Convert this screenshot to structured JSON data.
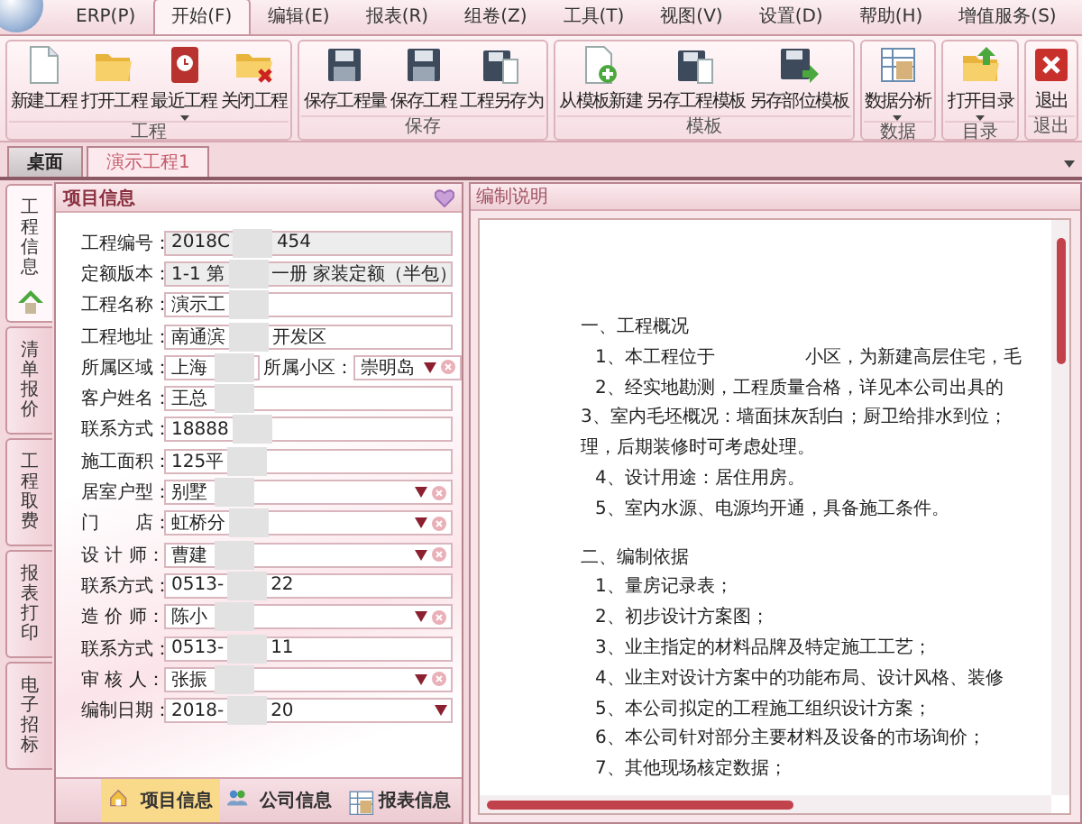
{
  "menu": {
    "tabs": [
      {
        "label": "ERP(P)",
        "selected": false
      },
      {
        "label": "开始(F)",
        "selected": true
      },
      {
        "label": "编辑(E)",
        "selected": false
      },
      {
        "label": "报表(R)",
        "selected": false
      },
      {
        "label": "组卷(Z)",
        "selected": false
      },
      {
        "label": "工具(T)",
        "selected": false
      },
      {
        "label": "视图(V)",
        "selected": false
      },
      {
        "label": "设置(D)",
        "selected": false
      },
      {
        "label": "帮助(H)",
        "selected": false
      },
      {
        "label": "增值服务(S)",
        "selected": false
      }
    ]
  },
  "ribbon": {
    "groups": [
      {
        "title": "工程",
        "buttons": [
          {
            "label": "新建工程",
            "kind": "new",
            "dropdown": false
          },
          {
            "label": "打开工程",
            "kind": "open",
            "dropdown": false
          },
          {
            "label": "最近工程",
            "kind": "recent",
            "dropdown": true
          },
          {
            "label": "关闭工程",
            "kind": "close",
            "dropdown": false
          }
        ]
      },
      {
        "title": "保存",
        "buttons": [
          {
            "label": "保存工程量",
            "kind": "save",
            "dropdown": false
          },
          {
            "label": "保存工程",
            "kind": "save",
            "dropdown": false
          },
          {
            "label": "工程另存为",
            "kind": "saveas",
            "dropdown": false
          }
        ]
      },
      {
        "title": "模板",
        "buttons": [
          {
            "label": "从模板新建",
            "kind": "fromtpl",
            "dropdown": false
          },
          {
            "label": "另存工程模板",
            "kind": "saveas",
            "dropdown": false
          },
          {
            "label": "另存部位模板",
            "kind": "savearrow",
            "dropdown": false
          }
        ]
      },
      {
        "title": "数据",
        "buttons": [
          {
            "label": "数据分析",
            "kind": "table",
            "dropdown": true
          }
        ]
      },
      {
        "title": "目录",
        "buttons": [
          {
            "label": "打开目录",
            "kind": "opendir",
            "dropdown": true
          }
        ]
      },
      {
        "title": "退出",
        "buttons": [
          {
            "label": "退出",
            "kind": "exit",
            "dropdown": false
          }
        ]
      }
    ]
  },
  "document_tabs": [
    {
      "label": "桌面",
      "selected": false
    },
    {
      "label": "演示工程1",
      "selected": true
    }
  ],
  "side_tabs": [
    {
      "label": "工程信息",
      "selected": true
    },
    {
      "label": "清单报价",
      "selected": false
    },
    {
      "label": "工程取费",
      "selected": false
    },
    {
      "label": "报表打印",
      "selected": false
    },
    {
      "label": "电子招标",
      "selected": false
    }
  ],
  "project_panel": {
    "title": "项目信息",
    "fields": [
      {
        "label": "工程编号：",
        "kind": "text",
        "readonly": true,
        "value": "2018C",
        "tail": "454"
      },
      {
        "label": "定额版本：",
        "kind": "text",
        "readonly": true,
        "value": "1-1 第",
        "tail": "一册 家装定额（半包）"
      },
      {
        "label": "工程名称：",
        "kind": "text",
        "readonly": false,
        "value": "演示工"
      },
      {
        "label": "工程地址：",
        "kind": "text",
        "readonly": false,
        "value": "南通滨",
        "tail": "开发区"
      },
      {
        "label": "所属区域：",
        "kind": "pair",
        "readonly": false,
        "value": "上海",
        "label2": "所属小区：",
        "value2": "崇明岛"
      },
      {
        "label": "客户姓名：",
        "kind": "text",
        "readonly": false,
        "value": "王总"
      },
      {
        "label": "联系方式：",
        "kind": "text",
        "readonly": false,
        "value": "18888"
      },
      {
        "label": "施工面积：",
        "kind": "text",
        "readonly": false,
        "value": "125平"
      },
      {
        "label": "居室户型：",
        "kind": "select",
        "readonly": false,
        "value": "别墅"
      },
      {
        "label": "门　　店：",
        "kind": "select",
        "readonly": false,
        "value": "虹桥分"
      },
      {
        "label": "设 计 师：",
        "kind": "select",
        "readonly": false,
        "value": "曹建"
      },
      {
        "label": "联系方式：",
        "kind": "text",
        "readonly": false,
        "value": "0513-",
        "tail": "22"
      },
      {
        "label": "造 价 师：",
        "kind": "select",
        "readonly": false,
        "value": "陈小"
      },
      {
        "label": "联系方式：",
        "kind": "text",
        "readonly": false,
        "value": "0513-",
        "tail": "11"
      },
      {
        "label": "审 核 人：",
        "kind": "select",
        "readonly": false,
        "value": "张振"
      },
      {
        "label": "编制日期：",
        "kind": "date",
        "readonly": false,
        "value": "2018-",
        "tail": "20"
      }
    ],
    "bottom_tabs": [
      {
        "label": "项目信息",
        "kind": "house",
        "selected": true
      },
      {
        "label": "公司信息",
        "kind": "people",
        "selected": false
      },
      {
        "label": "报表信息",
        "kind": "table",
        "selected": false
      }
    ]
  },
  "description_panel": {
    "title": "编制说明",
    "lines": [
      {
        "kind": "heading",
        "text": "一、工程概况"
      },
      {
        "kind": "item",
        "text": "1、本工程位于　　　　　小区，为新建高层住宅，毛"
      },
      {
        "kind": "item",
        "text": "2、经实地勘测，工程质量合格，详见本公司出具的"
      },
      {
        "kind": "flush",
        "text": "3、室内毛坯概况：墙面抹灰刮白；厨卫给排水到位；"
      },
      {
        "kind": "flush",
        "text": "理，后期装修时可考虑处理。"
      },
      {
        "kind": "item",
        "text": "4、设计用途：居住用房。"
      },
      {
        "kind": "item",
        "text": "5、室内水源、电源均开通，具备施工条件。"
      },
      {
        "kind": "heading",
        "text": "二、编制依据"
      },
      {
        "kind": "item",
        "text": "1、量房记录表；"
      },
      {
        "kind": "item",
        "text": "2、初步设计方案图；"
      },
      {
        "kind": "item",
        "text": "3、业主指定的材料品牌及特定施工工艺；"
      },
      {
        "kind": "item",
        "text": "4、业主对设计方案中的功能布局、设计风格、装修"
      },
      {
        "kind": "item",
        "text": "5、本公司拟定的工程施工组织设计方案；"
      },
      {
        "kind": "item",
        "text": "6、本公司针对部分主要材料及设备的市场询价；"
      },
      {
        "kind": "item",
        "text": "7、其他现场核定数据；"
      }
    ]
  }
}
